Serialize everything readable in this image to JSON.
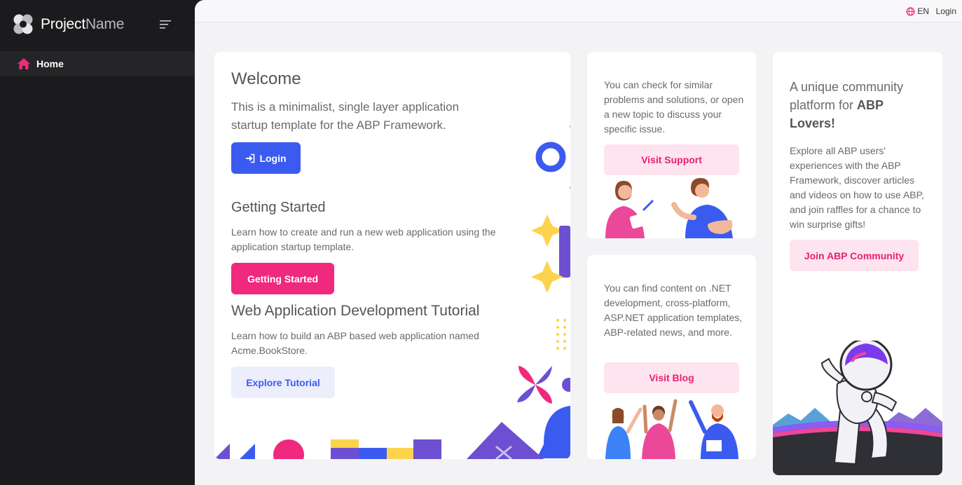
{
  "brand": {
    "name_part1": "Project",
    "name_part2": "Name"
  },
  "sidebar": {
    "items": [
      {
        "label": "Home",
        "icon": "home-icon",
        "active": true
      }
    ]
  },
  "topbar": {
    "language": "EN",
    "login": "Login"
  },
  "welcome": {
    "title": "Welcome",
    "description": "This is a minimalist, single layer application startup template for the ABP Framework.",
    "login_button": "Login"
  },
  "getting_started": {
    "title": "Getting Started",
    "description": "Learn how to create and run a new web application using the application startup template.",
    "button": "Getting Started"
  },
  "tutorial": {
    "title": "Web Application Development Tutorial",
    "description": "Learn how to build an ABP based web application named Acme.BookStore.",
    "button": "Explore Tutorial"
  },
  "support": {
    "description": "You can check for similar problems and solutions, or open a new topic to discuss your specific issue.",
    "button": "Visit Support"
  },
  "blog": {
    "description": "You can find content on .NET development, cross-platform, ASP.NET application templates, ABP-related news, and more.",
    "button": "Visit Blog"
  },
  "community": {
    "title_pre": "A unique community platform for ",
    "title_bold": "ABP Lovers!",
    "description": "Explore all ABP users' experiences with the ABP Framework, discover articles and videos on how to use ABP, and join raffles for a chance to win surprise gifts!",
    "button": "Join ABP Community"
  },
  "colors": {
    "primary_blue": "#3b5bf0",
    "accent_pink": "#f0287e",
    "sidebar_bg": "#1b1b1d",
    "page_bg": "#f3f3f6"
  }
}
